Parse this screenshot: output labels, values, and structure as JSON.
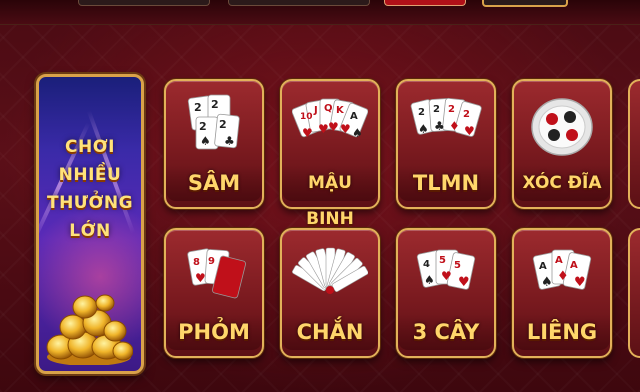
{
  "promo": {
    "line1": "CHƠI NHIỀU",
    "line2": "THƯỞNG LỚN"
  },
  "games": [
    {
      "label": "SÂM",
      "icon": "sam-cards-icon"
    },
    {
      "label": "MẬU BINH",
      "icon": "mau-binh-cards-icon"
    },
    {
      "label": "TLMN",
      "icon": "tlmn-cards-icon"
    },
    {
      "label": "XÓC ĐĨA",
      "icon": "xoc-dia-plate-icon"
    },
    {
      "label": "PHỎM",
      "icon": "phom-cards-icon"
    },
    {
      "label": "CHẮN",
      "icon": "chan-cards-fan-icon"
    },
    {
      "label": "3 CÂY",
      "icon": "3-cay-cards-icon"
    },
    {
      "label": "LIÊNG",
      "icon": "lieng-cards-icon"
    }
  ],
  "colors": {
    "tile_bg": "#7a1a1f",
    "tile_border": "#e2b15a",
    "label": "#ffd66b",
    "promo_bg": "#3a2aa8"
  }
}
